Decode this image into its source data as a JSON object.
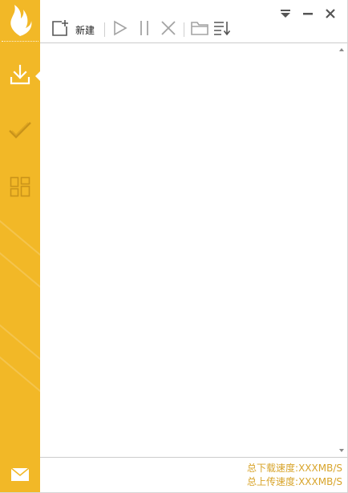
{
  "toolbar": {
    "new_label": "新建",
    "icons": [
      "new-task-icon",
      "play-icon",
      "pause-icon",
      "delete-icon",
      "folder-icon",
      "sort-icon"
    ]
  },
  "window_controls": {
    "icons": [
      "dropdown-menu-icon",
      "minimize-icon",
      "close-icon"
    ]
  },
  "sidebar": {
    "items": [
      {
        "name": "downloading",
        "icon": "download-icon",
        "active": true
      },
      {
        "name": "completed",
        "icon": "checkmark-icon",
        "active": false
      },
      {
        "name": "apps",
        "icon": "grid-icon",
        "active": false
      }
    ],
    "bottom_icon": "mail-icon"
  },
  "status": {
    "download_speed": "总下载速度:XXXMB/S",
    "upload_speed": "总上传速度:XXXMB/S"
  },
  "colors": {
    "sidebar": "#f2b827",
    "status_text": "#d8a42a",
    "icon_gray": "#555555",
    "icon_light": "#a3a3a3",
    "sidebar_icon_inactive": "#c9931a"
  }
}
